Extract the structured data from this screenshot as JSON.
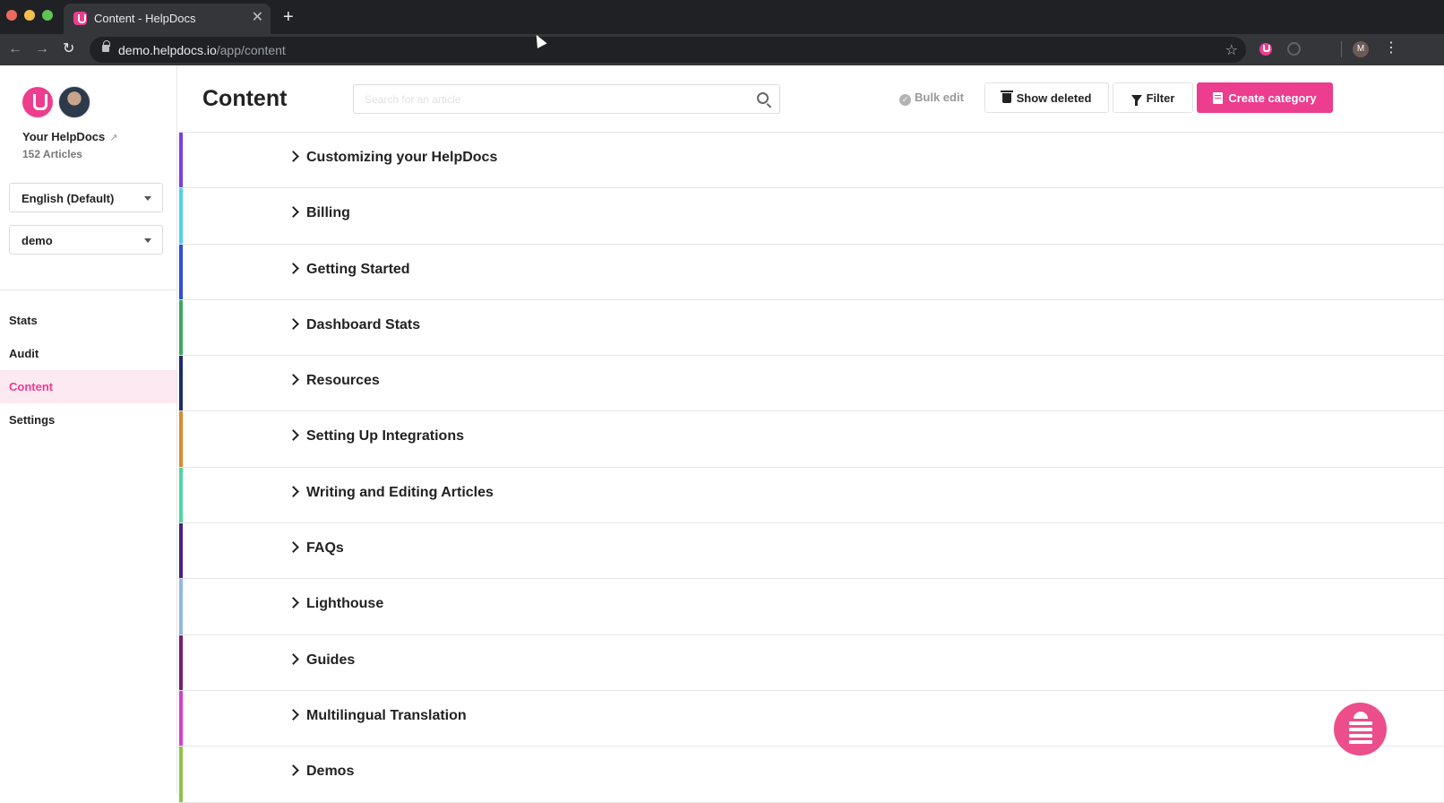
{
  "browser": {
    "tab_title": "Content - HelpDocs",
    "tab_close": "✕",
    "new_tab": "+",
    "url_host": "demo.helpdocs.io",
    "url_path": "/app/content",
    "profile_initial": "M",
    "nav": {
      "back": "←",
      "forward": "→",
      "reload": "↻",
      "star": "☆",
      "menu": "⋮"
    }
  },
  "sidebar": {
    "site_name": "Your HelpDocs",
    "article_count": "152 Articles",
    "language_select": "English (Default)",
    "project_select": "demo",
    "nav_items": [
      {
        "label": "Stats",
        "active": false
      },
      {
        "label": "Audit",
        "active": false
      },
      {
        "label": "Content",
        "active": true
      },
      {
        "label": "Settings",
        "active": false
      }
    ]
  },
  "header": {
    "title": "Content",
    "search_placeholder": "Search for an article",
    "bulk_edit": "Bulk edit",
    "show_deleted": "Show deleted",
    "filter": "Filter",
    "create_category": "Create category"
  },
  "categories": [
    {
      "name": "Customizing your HelpDocs",
      "color": "#7b3fe4"
    },
    {
      "name": "Billing",
      "color": "#4fd3e8"
    },
    {
      "name": "Getting Started",
      "color": "#2e4fd6"
    },
    {
      "name": "Dashboard Stats",
      "color": "#3aa860"
    },
    {
      "name": "Resources",
      "color": "#1f2a6b"
    },
    {
      "name": "Setting Up Integrations",
      "color": "#d98b2b"
    },
    {
      "name": "Writing and Editing Articles",
      "color": "#4ed6a3"
    },
    {
      "name": "FAQs",
      "color": "#4a1f86"
    },
    {
      "name": "Lighthouse",
      "color": "#8fb7e0"
    },
    {
      "name": "Guides",
      "color": "#7a1f6a"
    },
    {
      "name": "Multilingual Translation",
      "color": "#d43ed0"
    },
    {
      "name": "Demos",
      "color": "#8cc24a"
    }
  ],
  "colors": {
    "accent": "#ec3d8e",
    "active_nav_bg": "#fde9f2"
  }
}
